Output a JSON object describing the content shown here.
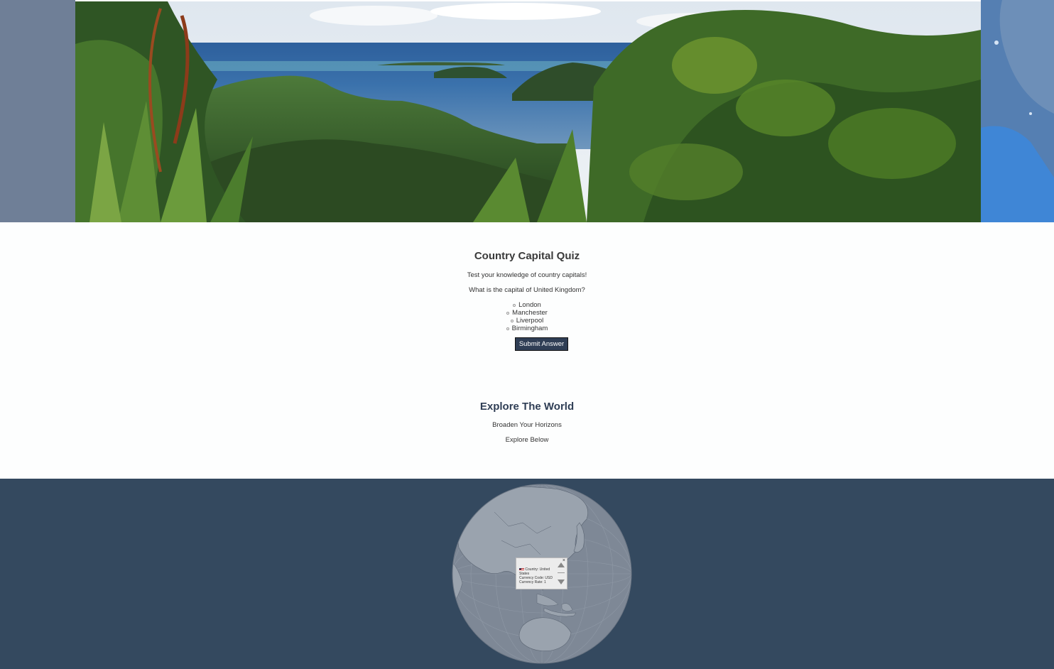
{
  "quiz": {
    "title": "Country Capital Quiz",
    "subtitle": "Test your knowledge of country capitals!",
    "question": "What is the capital of United Kingdom?",
    "options": [
      "London",
      "Manchester",
      "Liverpool",
      "Birmingham"
    ],
    "submit_label": "Submit Answer"
  },
  "explore": {
    "title": "Explore The World",
    "tagline": "Broaden Your Horizons",
    "cta": "Explore Below"
  },
  "globe_popup": {
    "close_symbol": "×",
    "country_line": "Country: United States",
    "currency_code_line": "Currency Code: USD",
    "currency_rate_line": "Currency Rate: 1"
  },
  "colors": {
    "primary_dark": "#2f3e55",
    "globe_background": "#34495f",
    "globe_land": "#9aa3ae",
    "globe_ocean": "#7e8896"
  },
  "icons": {
    "popup_close": "close-icon",
    "popup_scroll_up": "triangle-up-icon",
    "popup_scroll_down": "triangle-down-icon",
    "flag": "us-flag-icon"
  }
}
